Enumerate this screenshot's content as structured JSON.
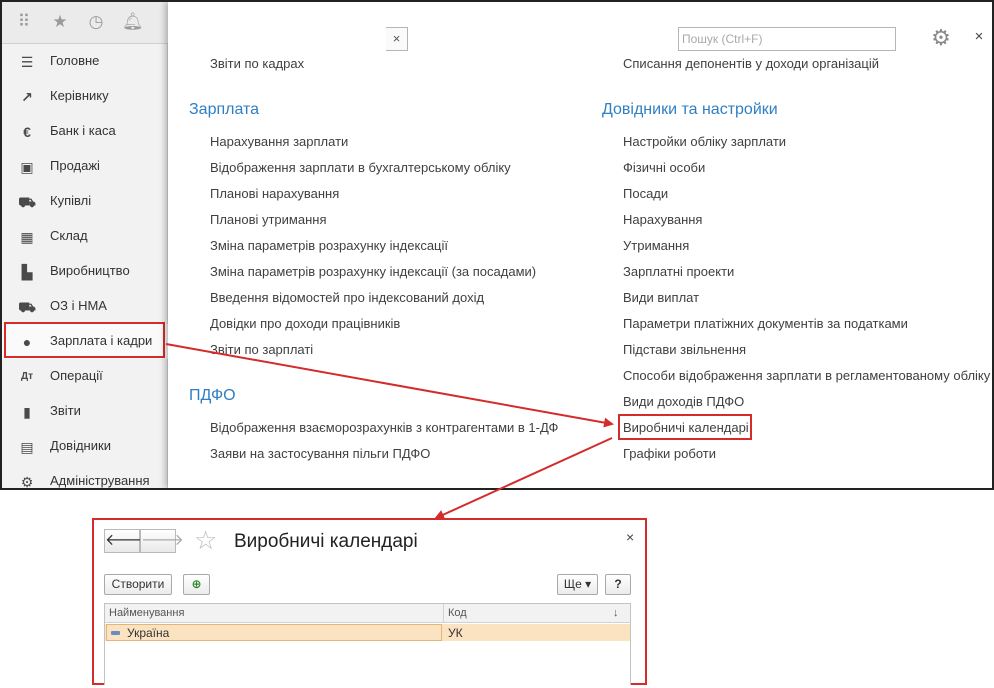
{
  "sidebar": {
    "items": [
      {
        "label": "Головне",
        "icon": "menu-lines-icon"
      },
      {
        "label": "Керівнику",
        "icon": "trend-chart-icon"
      },
      {
        "label": "Банк і каса",
        "icon": "coin-icon"
      },
      {
        "label": "Продажі",
        "icon": "cart-icon"
      },
      {
        "label": "Купівлі",
        "icon": "cart-icon"
      },
      {
        "label": "Склад",
        "icon": "grid-icon"
      },
      {
        "label": "Виробництво",
        "icon": "factory-icon"
      },
      {
        "label": "ОЗ і НМА",
        "icon": "truck-icon"
      },
      {
        "label": "Зарплата і кадри",
        "icon": "person-icon"
      },
      {
        "label": "Операції",
        "icon": "debit-credit-icon"
      },
      {
        "label": "Звіти",
        "icon": "bar-chart-icon"
      },
      {
        "label": "Довідники",
        "icon": "book-icon"
      },
      {
        "label": "Адміністрування",
        "icon": "gear-icon"
      }
    ]
  },
  "search": {
    "placeholder": "Пошук (Ctrl+F)",
    "clear": "×"
  },
  "panel": {
    "close": "×"
  },
  "left_column": {
    "top_link": "Звіти по кадрах",
    "sections": [
      {
        "title": "Зарплата",
        "links": [
          "Нарахування зарплати",
          "Відображення зарплати в бухгалтерському обліку",
          "Планові нарахування",
          "Планові утримання",
          "Зміна параметрів розрахунку індексації",
          "Зміна параметрів розрахунку індексації (за посадами)",
          "Введення відомостей про індексований дохід",
          "Довідки про доходи працівників",
          "Звіти по зарплаті"
        ]
      },
      {
        "title": "ПДФО",
        "links": [
          "Відображення взаєморозрахунків з контрагентами в 1-ДФ",
          "Заяви на застосування пільги ПДФО"
        ]
      }
    ]
  },
  "right_column": {
    "top_link": "Списання депонентів у доходи організацій",
    "section": {
      "title": "Довідники та настройки",
      "links": [
        "Настройки обліку зарплати",
        "Фізичні особи",
        "Посади",
        "Нарахування",
        "Утримання",
        "Зарплатні проекти",
        "Види виплат",
        "Параметри платіжних документів за податками",
        "Підстави звільнення",
        "Способи відображення зарплати в регламентованому обліку",
        "Види доходів ПДФО",
        "Виробничі календарі",
        "Графіки роботи"
      ]
    }
  },
  "calendar_window": {
    "title": "Виробничі календарі",
    "back": "🡐",
    "forward": "🡒",
    "close": "×",
    "create_button": "Створити",
    "more_button": "Ще ▾",
    "help_button": "?",
    "columns": [
      "Найменування",
      "Код",
      "↓"
    ],
    "rows": [
      {
        "name": "Україна",
        "code": "УК"
      }
    ]
  },
  "colors": {
    "highlight": "#d42b2b",
    "section_title": "#2f7fc4",
    "selected_row": "#fbe3c2"
  }
}
